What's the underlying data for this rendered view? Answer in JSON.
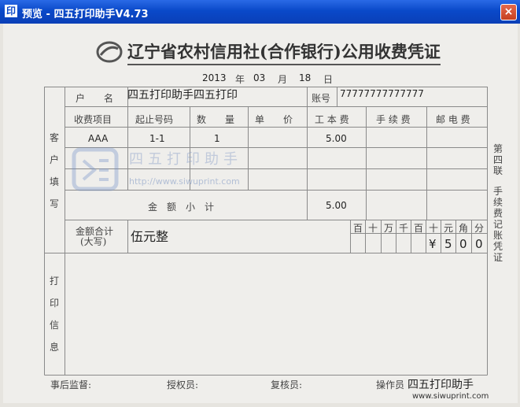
{
  "window": {
    "title": "预览 - 四五打印助手V4.73",
    "icon": "siwu-icon",
    "close": "×"
  },
  "voucher": {
    "title": "辽宁省农村信用社(合作银行)公用收费凭证",
    "date": {
      "year": "2013",
      "year_label": "年",
      "month": "03",
      "month_label": "月",
      "day": "18",
      "day_label": "日"
    },
    "left_label_top": [
      "客",
      "户",
      "填",
      "写"
    ],
    "left_label_bottom": [
      "打",
      "印",
      "信",
      "息"
    ],
    "right_label": [
      "第",
      "四",
      "联",
      "手",
      "续",
      "费",
      "记",
      "账",
      "凭",
      "证"
    ],
    "payer_label": "户　　名",
    "payer_value": "四五打印助手四五打印",
    "account_label": "账号",
    "account_value": "77777777777777",
    "headers": [
      "收费项目",
      "起止号码",
      "数　　量",
      "单　　价",
      "工 本 费",
      "手 续 费",
      "邮 电 费"
    ],
    "row": {
      "item": "AAA",
      "range": "1-1",
      "qty": "1",
      "cost": "5.00"
    },
    "subtotal_label": "金　额　小　计",
    "subtotal_value": "5.00",
    "total_label_1": "金额合计",
    "total_label_2": "(大写)",
    "total_words": "伍元整",
    "units": [
      "百",
      "十",
      "万",
      "千",
      "百",
      "十",
      "元",
      "角",
      "分"
    ],
    "amount_digits": [
      "¥",
      "5",
      "0",
      "0"
    ],
    "watermark": {
      "text": "四五打印助手",
      "url": "http://www.siwuprint.com"
    },
    "footer": {
      "supervisor": "事后监督:",
      "authorizer": "授权员:",
      "reviewer": "复核员:",
      "operator": "操作员",
      "operator_value": "四五打印助手",
      "site": "www.siwuprint.com"
    }
  },
  "colors": {
    "titlebar": "#0a49c9",
    "paper": "#efeeeb",
    "lines": "#888888"
  }
}
